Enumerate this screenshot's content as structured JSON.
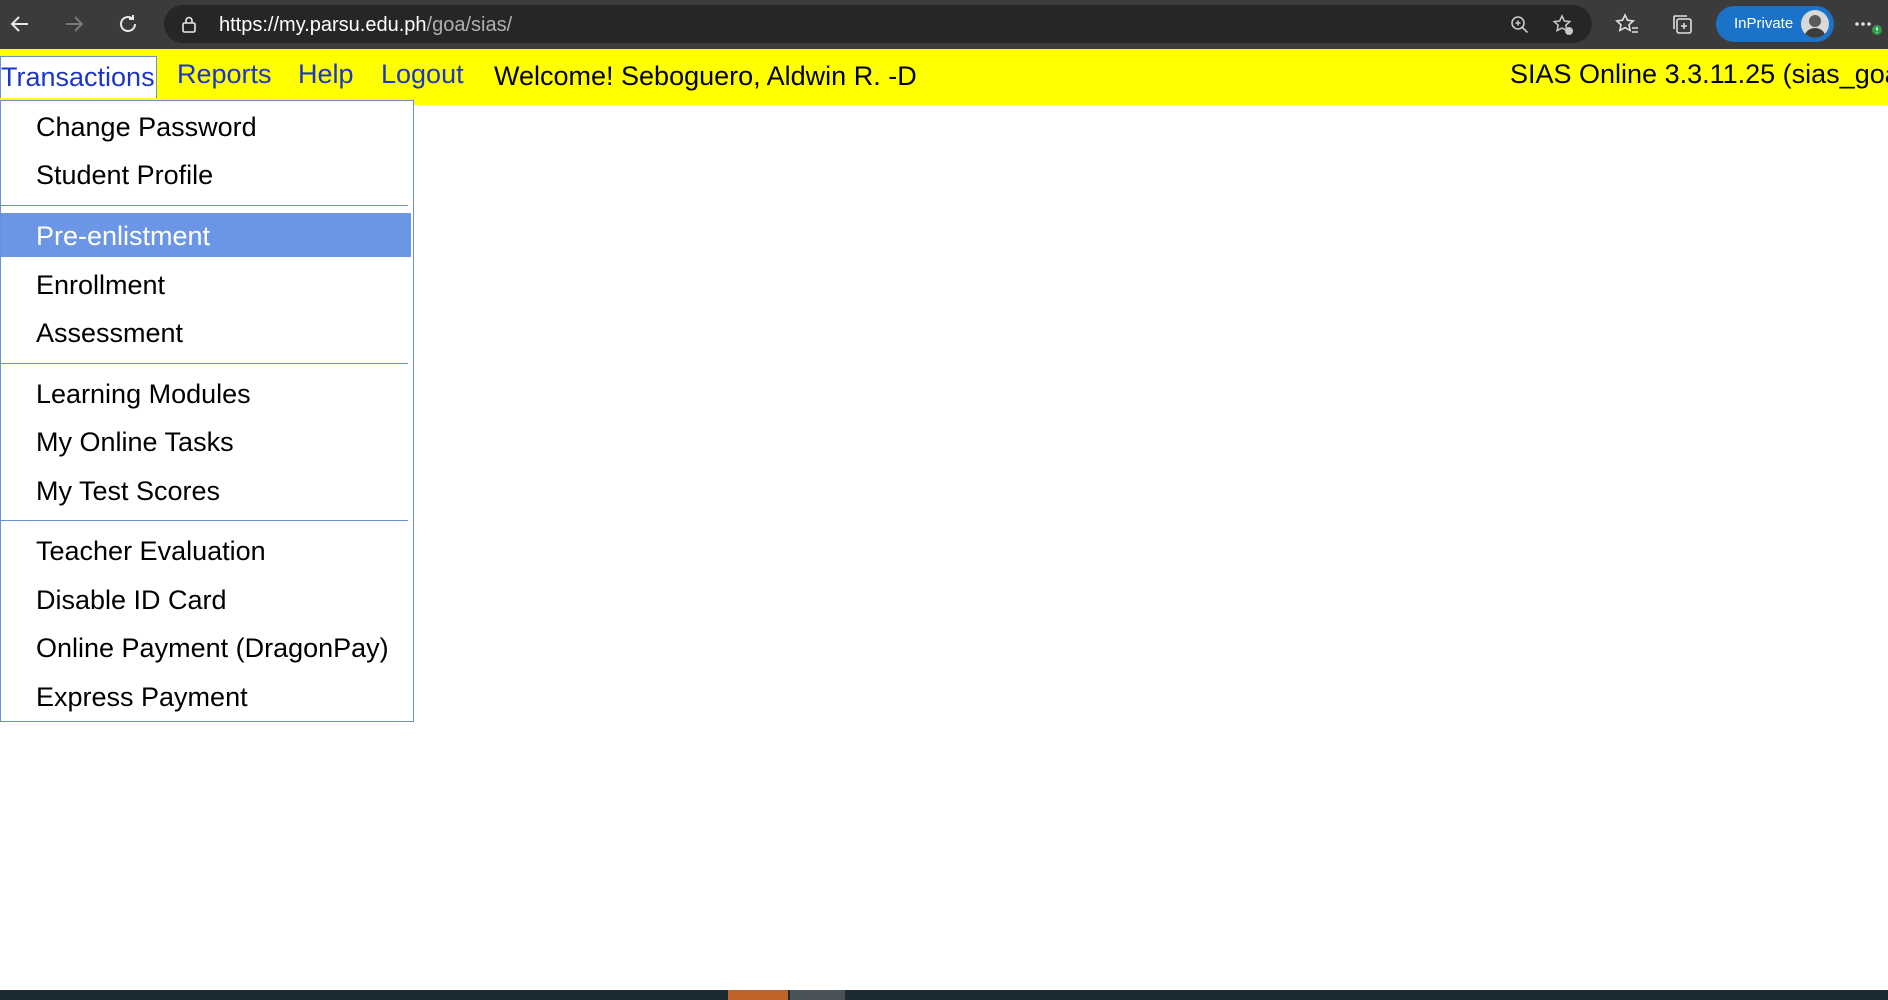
{
  "browser": {
    "url_host": "https://my.parsu.edu.ph",
    "url_path": "/goa/sias/",
    "inprivate_label": "InPrivate"
  },
  "menubar": {
    "items": [
      {
        "label": "Transactions"
      },
      {
        "label": "Reports"
      },
      {
        "label": "Help"
      },
      {
        "label": "Logout"
      }
    ],
    "welcome": "Welcome! Seboguero, Aldwin R. -D",
    "version": "SIAS Online 3.3.11.25 (sias_goa"
  },
  "dropdown": {
    "items": [
      {
        "label": "Change Password"
      },
      {
        "label": "Student Profile"
      },
      {
        "label": "Pre-enlistment"
      },
      {
        "label": "Enrollment"
      },
      {
        "label": "Assessment"
      },
      {
        "label": "Learning Modules"
      },
      {
        "label": "My Online Tasks"
      },
      {
        "label": "My Test Scores"
      },
      {
        "label": "Teacher Evaluation"
      },
      {
        "label": "Disable ID Card"
      },
      {
        "label": "Online Payment (DragonPay)"
      },
      {
        "label": "Express Payment"
      }
    ],
    "active_item": "Pre-enlistment"
  },
  "colors": {
    "menubar_bg": "#ffff00",
    "menu_link": "#1a37c8",
    "active_bg": "#6b96e6",
    "border": "#6b8fd3"
  }
}
